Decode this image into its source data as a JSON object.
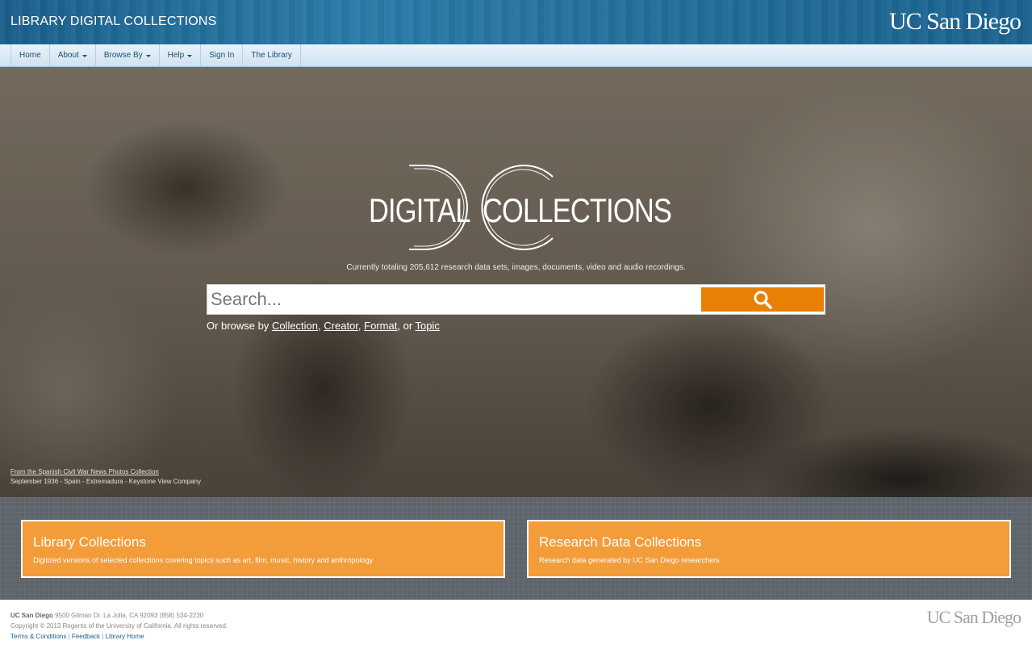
{
  "header": {
    "site_title": "LIBRARY DIGITAL COLLECTIONS",
    "brand": "UC San Diego"
  },
  "nav": {
    "items": [
      {
        "label": "Home",
        "dropdown": false
      },
      {
        "label": "About",
        "dropdown": true
      },
      {
        "label": "Browse By",
        "dropdown": true
      },
      {
        "label": "Help",
        "dropdown": true
      },
      {
        "label": "Sign In",
        "dropdown": false
      },
      {
        "label": "The Library",
        "dropdown": false
      }
    ]
  },
  "hero": {
    "logo_left": "DIGITAL",
    "logo_right": "COLLECTIONS",
    "tagline": "Currently totaling 205,612 research data sets, images, documents, video and audio recordings.",
    "search": {
      "placeholder": "Search...",
      "button_icon": "search-icon"
    },
    "browse": {
      "prefix": "Or browse by",
      "collection": "Collection",
      "creator": "Creator",
      "format": "Format",
      "topic": "Topic",
      "or": "or"
    },
    "caption": {
      "link": "From the Spanish Civil War News Photos Collection",
      "detail": "September 1936 - Spain - Extremadura - Keystone View Company"
    }
  },
  "cards": [
    {
      "title": "Library Collections",
      "description": "Digitized versions of selected collections covering topics such as art, film, music, history and anthropology"
    },
    {
      "title": "Research Data Collections",
      "description": "Research data generated by UC San Diego researchers"
    }
  ],
  "footer": {
    "org": "UC San Diego",
    "address": "9500 Gilman Dr. La Jolla, CA 92093 (858) 534-2230",
    "copyright": "Copyright © 2013 Regents of the University of California. All rights reserved.",
    "links": [
      "Terms & Conditions",
      "Feedback",
      "Library Home"
    ],
    "brand": "UC San Diego"
  },
  "colors": {
    "header_blue": "#236f9d",
    "accent_orange": "#e98006",
    "card_orange": "#f39c3a",
    "band_gray": "#5d646b"
  }
}
